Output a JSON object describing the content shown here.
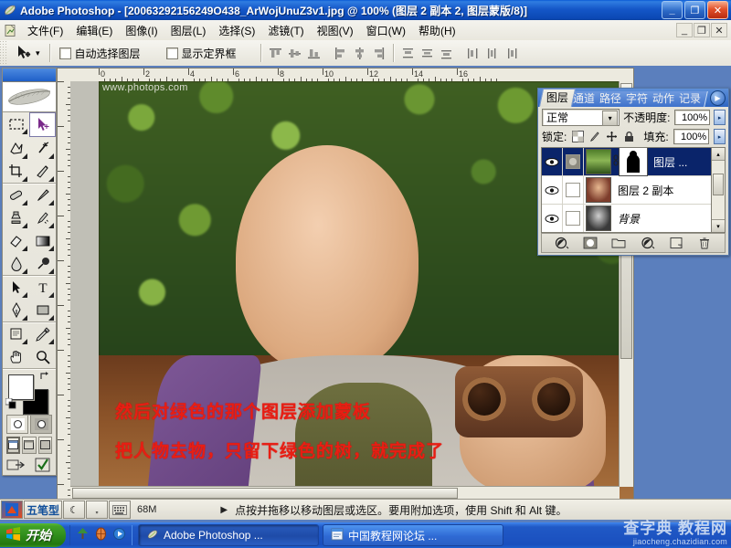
{
  "window": {
    "title": "Adobe Photoshop - [20063292156249O438_ArWojUnuZ3v1.jpg @ 100% (图层 2 副本 2, 图层蒙版/8)]",
    "app_icon": "photoshop-feather-icon",
    "minimize_label": "_",
    "restore_label": "❐",
    "close_label": "✕",
    "doc_minimize_label": "_",
    "doc_restore_label": "❐",
    "doc_close_label": "✕"
  },
  "menubar": {
    "doc_icon": "document-icon",
    "items": [
      {
        "label": "文件(F)"
      },
      {
        "label": "编辑(E)"
      },
      {
        "label": "图像(I)"
      },
      {
        "label": "图层(L)"
      },
      {
        "label": "选择(S)"
      },
      {
        "label": "滤镜(T)"
      },
      {
        "label": "视图(V)"
      },
      {
        "label": "窗口(W)"
      },
      {
        "label": "帮助(H)"
      }
    ]
  },
  "options_bar": {
    "tool_icon": "move-tool-icon",
    "tool_dropdown": "▾",
    "auto_select_label": "自动选择图层",
    "show_bounding_box_label": "显示定界框",
    "align_group_1": [
      "align-top-edges-icon",
      "align-vertical-centers-icon",
      "align-bottom-edges-icon"
    ],
    "align_group_2": [
      "align-left-edges-icon",
      "align-horizontal-centers-icon",
      "align-right-edges-icon"
    ],
    "distribute_group_1": [
      "distribute-top-edges-icon",
      "distribute-vertical-centers-icon",
      "distribute-bottom-edges-icon"
    ],
    "distribute_group_2": [
      "distribute-left-edges-icon",
      "distribute-horizontal-centers-icon",
      "distribute-right-edges-icon"
    ]
  },
  "toolbox": {
    "logo": "photoshop-feather-logo",
    "tools": [
      {
        "name": "marquee-tool-icon",
        "active": false
      },
      {
        "name": "move-tool-icon",
        "active": true
      },
      {
        "name": "lasso-tool-icon",
        "active": false
      },
      {
        "name": "magic-wand-tool-icon",
        "active": false
      },
      {
        "name": "crop-tool-icon",
        "active": false
      },
      {
        "name": "slice-tool-icon",
        "active": false
      },
      {
        "name": "healing-brush-tool-icon",
        "active": false
      },
      {
        "name": "brush-tool-icon",
        "active": false
      },
      {
        "name": "clone-stamp-tool-icon",
        "active": false
      },
      {
        "name": "history-brush-tool-icon",
        "active": false
      },
      {
        "name": "eraser-tool-icon",
        "active": false
      },
      {
        "name": "gradient-tool-icon",
        "active": false
      },
      {
        "name": "blur-tool-icon",
        "active": false
      },
      {
        "name": "dodge-tool-icon",
        "active": false
      },
      {
        "name": "path-selection-tool-icon",
        "active": false
      },
      {
        "name": "type-tool-icon",
        "active": false
      },
      {
        "name": "pen-tool-icon",
        "active": false
      },
      {
        "name": "shape-tool-icon",
        "active": false
      },
      {
        "name": "notes-tool-icon",
        "active": false
      },
      {
        "name": "eyedropper-tool-icon",
        "active": false
      },
      {
        "name": "hand-tool-icon",
        "active": false
      },
      {
        "name": "zoom-tool-icon",
        "active": false
      }
    ],
    "foreground_color": "#ffffff",
    "background_color": "#000000",
    "swap_colors_icon": "swap-colors-icon",
    "default_colors_icon": "default-colors-icon",
    "quickmask": [
      "standard-mode-icon",
      "quick-mask-mode-icon"
    ],
    "screenmode": [
      "standard-screen-mode-icon",
      "full-screen-menubar-icon",
      "full-screen-icon"
    ],
    "jump_to": [
      "jump-to-imageready-icon",
      "jump-check-icon"
    ]
  },
  "document": {
    "ruler_unit_marks": [
      "0",
      "2",
      "4",
      "6",
      "8",
      "10",
      "12",
      "14",
      "16"
    ],
    "image_watermark": "www.photops.com",
    "annotations": [
      {
        "text": "然后对绿色的那个图层添加蒙板",
        "color": "#e81e13"
      },
      {
        "text": "把人物去物，只留下绿色的树，就完成了",
        "color": "#e81e13"
      }
    ]
  },
  "layers_palette": {
    "tabs": [
      {
        "label": "图层",
        "active": true
      },
      {
        "label": "通道",
        "active": false
      },
      {
        "label": "路径",
        "active": false
      },
      {
        "label": "字符",
        "active": false
      },
      {
        "label": "动作",
        "active": false
      },
      {
        "label": "记录",
        "active": false
      }
    ],
    "menu_icon": "palette-menu-icon",
    "blend_mode": "正常",
    "blend_mode_arrow": "▾",
    "opacity_label": "不透明度:",
    "opacity_value": "100%",
    "opacity_arrow": "▸",
    "lock_label": "锁定:",
    "lock_icons": [
      "lock-transparency-icon",
      "lock-pixels-icon",
      "lock-position-icon",
      "lock-all-icon"
    ],
    "fill_label": "填充:",
    "fill_value": "100%",
    "fill_arrow": "▸",
    "layers": [
      {
        "name": "图层 ...",
        "visible": true,
        "selected": true,
        "has_mask": true,
        "link_icon": "link-icon",
        "eye_icon": "eye-icon",
        "mask_box_icon": "layer-mask-indicator-icon",
        "locked": false
      },
      {
        "name": "图层 2 副本",
        "visible": true,
        "selected": false,
        "has_mask": false,
        "eye_icon": "eye-icon",
        "locked": false
      },
      {
        "name": "背景",
        "visible": true,
        "selected": false,
        "has_mask": false,
        "eye_icon": "eye-icon",
        "locked": true,
        "lock_icon": "lock-icon"
      }
    ],
    "scroll_up_arrow": "▴",
    "scroll_down_arrow": "▾",
    "footer_buttons": [
      {
        "name": "layer-style-button",
        "glyph": "layer-style-icon"
      },
      {
        "name": "add-layer-mask-button",
        "glyph": "add-mask-icon"
      },
      {
        "name": "new-group-button",
        "glyph": "folder-icon"
      },
      {
        "name": "adjustment-layer-button",
        "glyph": "adjustment-icon"
      },
      {
        "name": "new-layer-button",
        "glyph": "new-layer-icon"
      },
      {
        "name": "delete-layer-button",
        "glyph": "trash-icon"
      }
    ]
  },
  "status_bar": {
    "ime_logo": "ime-logo-icon",
    "ime_name": "五笔型",
    "ime_buttons": [
      "half-width-icon",
      "punctuation-icon",
      "soft-keyboard-icon"
    ],
    "doc_size": "68M",
    "play_arrow": "▶",
    "hint": "点按并拖移以移动图层或选区。要用附加选项，使用 Shift 和 Alt 键。"
  },
  "taskbar": {
    "start_label": "开始",
    "start_icon": "windows-flag-icon",
    "quicklaunch": [
      "desktop-icon",
      "browser-icon",
      "media-icon"
    ],
    "tasks": [
      {
        "label": "Adobe Photoshop ...",
        "icon": "photoshop-icon",
        "active": true
      },
      {
        "label": "中国教程网论坛 ...",
        "icon": "browser-window-icon",
        "active": false
      }
    ],
    "watermark_main": "查字典 教程网",
    "watermark_sub": "jiaocheng.chazidian.com"
  }
}
